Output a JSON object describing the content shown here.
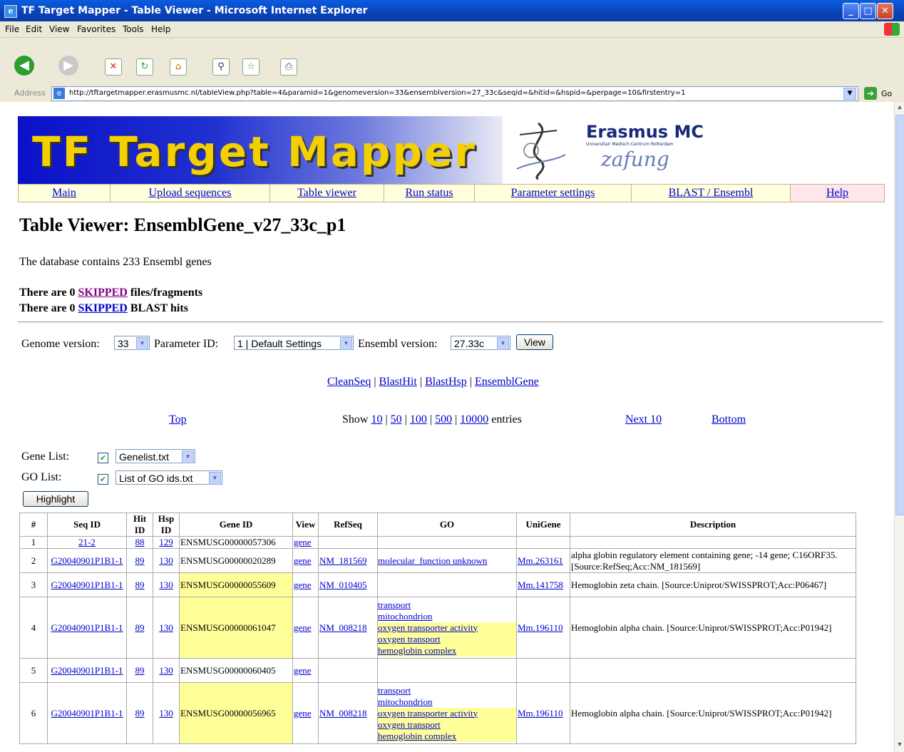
{
  "window": {
    "title": "TF Target Mapper - Table Viewer - Microsoft Internet Explorer"
  },
  "menu": [
    "File",
    "Edit",
    "View",
    "Favorites",
    "Tools",
    "Help"
  ],
  "address": {
    "label": "Address",
    "url": "http://tftargetmapper.erasmusmc.nl/tableView.php?table=4&paramid=1&genomeversion=33&ensemblversion=27_33c&seqid=&hitid=&hspid=&perpage=10&firstentry=1",
    "go": "Go"
  },
  "banner": {
    "logo": "TF Target Mapper",
    "org": "Erasmus MC",
    "org_sub": "Universitair Medisch Centrum Rotterdam",
    "signature": "zafung"
  },
  "nav": [
    "Main",
    "Upload sequences",
    "Table viewer",
    "Run status",
    "Parameter settings",
    "BLAST / Ensembl",
    "Help"
  ],
  "page": {
    "title": "Table Viewer:  EnsemblGene_v27_33c_p1",
    "db_info": "The database contains 233 Ensembl genes",
    "skipped1_pre": "There are 0 ",
    "skipped1_link": "SKIPPED",
    "skipped1_post": " files/fragments",
    "skipped2_pre": "There are 0 ",
    "skipped2_link": "SKIPPED",
    "skipped2_post": " BLAST hits"
  },
  "controls": {
    "genome_label": "Genome version:",
    "genome_value": "33",
    "param_label": "Parameter ID:",
    "param_value": "1 | Default Settings",
    "ensembl_label": "Ensembl version:",
    "ensembl_value": "27.33c",
    "view_button": "View"
  },
  "tables_links": [
    "CleanSeq",
    "BlastHit",
    "BlastHsp",
    "EnsemblGene"
  ],
  "pager": {
    "top": "Top",
    "show": "Show",
    "options": [
      "10",
      "50",
      "100",
      "500",
      "10000"
    ],
    "entries": "entries",
    "next": "Next 10",
    "bottom": "Bottom"
  },
  "lists": {
    "gene_label": "Gene List:",
    "gene_value": "Genelist.txt",
    "go_label": "GO List:",
    "go_value": "List of GO ids.txt",
    "highlight_button": "Highlight"
  },
  "table": {
    "headers": [
      "#",
      "Seq ID",
      "Hit ID",
      "Hsp ID",
      "Gene ID",
      "View",
      "RefSeq",
      "GO",
      "UniGene",
      "Description"
    ],
    "rows": [
      {
        "n": "1",
        "seq": "21-2",
        "hit": "88",
        "hsp": "129",
        "gene": "ENSMUSG00000057306",
        "gene_hl": false,
        "view": "gene",
        "refseq": "",
        "go": [],
        "unigene": "",
        "desc": ""
      },
      {
        "n": "2",
        "seq": "G20040901P1B1-1",
        "hit": "89",
        "hsp": "130",
        "gene": "ENSMUSG00000020289",
        "gene_hl": false,
        "view": "gene",
        "refseq": "NM_181569",
        "go": [
          {
            "t": "molecular_function unknown",
            "hl": false
          }
        ],
        "unigene": "Mm.263161",
        "desc": "alpha globin regulatory element containing gene; -14 gene; C16ORF35. [Source:RefSeq;Acc:NM_181569]"
      },
      {
        "n": "3",
        "seq": "G20040901P1B1-1",
        "hit": "89",
        "hsp": "130",
        "gene": "ENSMUSG00000055609",
        "gene_hl": true,
        "view": "gene",
        "refseq": "NM_010405",
        "go": [],
        "unigene": "Mm.141758",
        "desc": "Hemoglobin zeta chain. [Source:Uniprot/SWISSPROT;Acc:P06467]"
      },
      {
        "n": "4",
        "seq": "G20040901P1B1-1",
        "hit": "89",
        "hsp": "130",
        "gene": "ENSMUSG00000061047",
        "gene_hl": true,
        "view": "gene",
        "refseq": "NM_008218",
        "go": [
          {
            "t": "transport",
            "hl": false
          },
          {
            "t": "mitochondrion",
            "hl": false
          },
          {
            "t": "oxygen transporter activity",
            "hl": true
          },
          {
            "t": "oxygen transport",
            "hl": true
          },
          {
            "t": "hemoglobin complex",
            "hl": true
          }
        ],
        "unigene": "Mm.196110",
        "desc": "Hemoglobin alpha chain. [Source:Uniprot/SWISSPROT;Acc:P01942]"
      },
      {
        "n": "5",
        "seq": "G20040901P1B1-1",
        "hit": "89",
        "hsp": "130",
        "gene": "ENSMUSG00000060405",
        "gene_hl": false,
        "view": "gene",
        "refseq": "",
        "go": [],
        "unigene": "",
        "desc": ""
      },
      {
        "n": "6",
        "seq": "G20040901P1B1-1",
        "hit": "89",
        "hsp": "130",
        "gene": "ENSMUSG00000056965",
        "gene_hl": true,
        "view": "gene",
        "refseq": "NM_008218",
        "go": [
          {
            "t": "transport",
            "hl": false
          },
          {
            "t": "mitochondrion",
            "hl": false
          },
          {
            "t": "oxygen transporter activity",
            "hl": true
          },
          {
            "t": "oxygen transport",
            "hl": true
          },
          {
            "t": "hemoglobin complex",
            "hl": true
          }
        ],
        "unigene": "Mm.196110",
        "desc": "Hemoglobin alpha chain. [Source:Uniprot/SWISSPROT;Acc:P01942]"
      }
    ]
  },
  "colors": {
    "highlight": "#ffff99",
    "link": "#0000cc",
    "nav_bg": "#ffffdd",
    "title_bar": "#0a5ce0"
  }
}
